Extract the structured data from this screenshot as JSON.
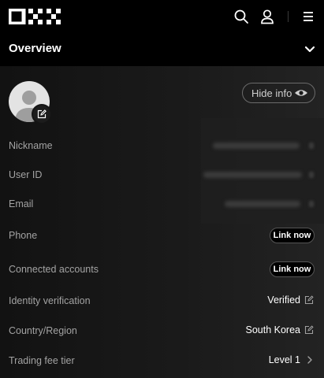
{
  "header": {
    "logo_icon": "okx-logo-icon",
    "search_icon": "search-icon",
    "profile_icon": "user-icon",
    "menu_icon": "hamburger-menu-icon"
  },
  "overview": {
    "title": "Overview",
    "toggle_icon": "chevron-down-icon"
  },
  "profile": {
    "avatar_icon": "avatar-placeholder-icon",
    "edit_icon": "edit-icon",
    "hide_info_label": "Hide info",
    "hide_info_icon": "eye-icon"
  },
  "rows": {
    "nickname": {
      "label": "Nickname"
    },
    "user_id": {
      "label": "User ID"
    },
    "email": {
      "label": "Email"
    },
    "phone": {
      "label": "Phone",
      "action": "Link now"
    },
    "connected": {
      "label": "Connected accounts",
      "action": "Link now"
    },
    "identity": {
      "label": "Identity verification",
      "value": "Verified",
      "icon": "edit-icon"
    },
    "country": {
      "label": "Country/Region",
      "value": "South Korea",
      "icon": "edit-icon"
    },
    "fee_tier": {
      "label": "Trading fee tier",
      "value": "Level 1",
      "icon": "chevron-right-icon"
    }
  },
  "colors": {
    "background": "#000000",
    "panel": "#1a1a1a",
    "label": "#a3a3a3",
    "value": "#ffffff",
    "pill_border": "#555555"
  }
}
